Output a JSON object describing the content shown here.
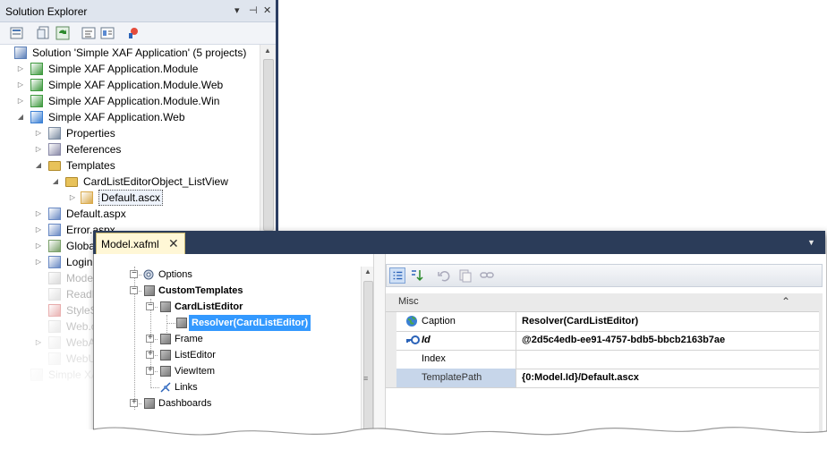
{
  "solution_explorer": {
    "title": "Solution Explorer",
    "controls": [
      "▾",
      "⊣",
      "✕"
    ],
    "toolbar": [
      "properties",
      "show-all-files",
      "refresh",
      "view-code",
      "view-designer",
      "class-diagram"
    ],
    "items": [
      {
        "label": "Solution 'Simple XAF Application' (5 projects)",
        "icon": "solution-icon",
        "level": 0,
        "arrow": ""
      },
      {
        "label": "Simple XAF Application.Module",
        "icon": "csharp-project-icon",
        "level": 1,
        "arrow": "▷"
      },
      {
        "label": "Simple XAF Application.Module.Web",
        "icon": "csharp-project-icon",
        "level": 1,
        "arrow": "▷"
      },
      {
        "label": "Simple XAF Application.Module.Win",
        "icon": "csharp-project-icon",
        "level": 1,
        "arrow": "▷"
      },
      {
        "label": "Simple XAF Application.Web",
        "icon": "web-project-icon",
        "level": 1,
        "arrow": "◢"
      },
      {
        "label": "Properties",
        "icon": "properties-icon",
        "level": 2,
        "arrow": "▷"
      },
      {
        "label": "References",
        "icon": "references-icon",
        "level": 2,
        "arrow": "▷"
      },
      {
        "label": "Templates",
        "icon": "folder-icon",
        "level": 2,
        "arrow": "◢"
      },
      {
        "label": "CardListEditorObject_ListView",
        "icon": "folder-icon",
        "level": 3,
        "arrow": "◢"
      },
      {
        "label": "Default.ascx",
        "icon": "ascx-file-icon",
        "level": 4,
        "arrow": "▷"
      },
      {
        "label": "Default.aspx",
        "icon": "aspx-file-icon",
        "level": 2,
        "arrow": "▷"
      },
      {
        "label": "Error.aspx",
        "icon": "aspx-file-icon",
        "level": 2,
        "arrow": "▷"
      },
      {
        "label": "Global.asax",
        "icon": "asax-file-icon",
        "level": 2,
        "arrow": "▷"
      },
      {
        "label": "Login.aspx",
        "icon": "aspx-file-icon",
        "level": 2,
        "arrow": "▷"
      },
      {
        "label": "Model.xafml",
        "icon": "model-icon",
        "level": 2,
        "arrow": ""
      },
      {
        "label": "ReadMe.txt",
        "icon": "text-file-icon",
        "level": 2,
        "arrow": ""
      },
      {
        "label": "StyleSheet.css",
        "icon": "css-file-icon",
        "level": 2,
        "arrow": ""
      },
      {
        "label": "Web.config",
        "icon": "config-file-icon",
        "level": 2,
        "arrow": ""
      },
      {
        "label": "WebApplication.cs",
        "icon": "cs-file-icon",
        "level": 2,
        "arrow": "▷"
      },
      {
        "label": "WebUserControl.ascx",
        "icon": "cs-file-icon",
        "level": 2,
        "arrow": ""
      },
      {
        "label": "Simple XAF Application.Win",
        "icon": "win-project-icon",
        "level": 1,
        "arrow": ""
      }
    ]
  },
  "model_editor": {
    "tab_title": "Model.xafml",
    "tab_close": "✕",
    "dropdown": "▼",
    "tree": [
      {
        "label": "Options",
        "bold": false,
        "selected": false,
        "icon": "gear-icon"
      },
      {
        "label": "CustomTemplates",
        "bold": true,
        "selected": false,
        "icon": "cube-icon"
      },
      {
        "label": "CardListEditor",
        "bold": true,
        "selected": false,
        "icon": "cube-icon"
      },
      {
        "label": "Resolver(CardListEditor)",
        "bold": true,
        "selected": true,
        "icon": "cube-icon"
      },
      {
        "label": "Frame",
        "bold": false,
        "selected": false,
        "icon": "cube-icon"
      },
      {
        "label": "ListEditor",
        "bold": false,
        "selected": false,
        "icon": "cube-icon"
      },
      {
        "label": "ViewItem",
        "bold": false,
        "selected": false,
        "icon": "cube-icon"
      },
      {
        "label": "Links",
        "bold": false,
        "selected": false,
        "icon": "links-icon"
      },
      {
        "label": "Dashboards",
        "bold": false,
        "selected": false,
        "icon": "cube-icon"
      }
    ],
    "property_grid": {
      "toolbar": [
        "categorized",
        "alphabetical",
        "undo",
        "copy",
        "link"
      ],
      "category": "Misc",
      "collapse_glyph": "⌃",
      "rows": [
        {
          "name": "Caption",
          "value": "Resolver(CardListEditor)",
          "icon": "globe-icon",
          "italic": false,
          "bold": false
        },
        {
          "name": "Id",
          "value": "@2d5c4edb-ee91-4757-bdb5-bbcb2163b7ae",
          "icon": "key-icon",
          "italic": true,
          "bold": true
        },
        {
          "name": "Index",
          "value": "",
          "icon": "",
          "italic": false,
          "bold": false
        },
        {
          "name": "TemplatePath",
          "value": "{0:Model.Id}/Default.ascx",
          "icon": "",
          "italic": false,
          "bold": false
        }
      ]
    }
  },
  "colors": {
    "se_title_bg": "#dfe5ee",
    "tab_active_bg": "#fff7d6",
    "dark_chrome": "#2b3c59",
    "selection": "#3399ff"
  }
}
